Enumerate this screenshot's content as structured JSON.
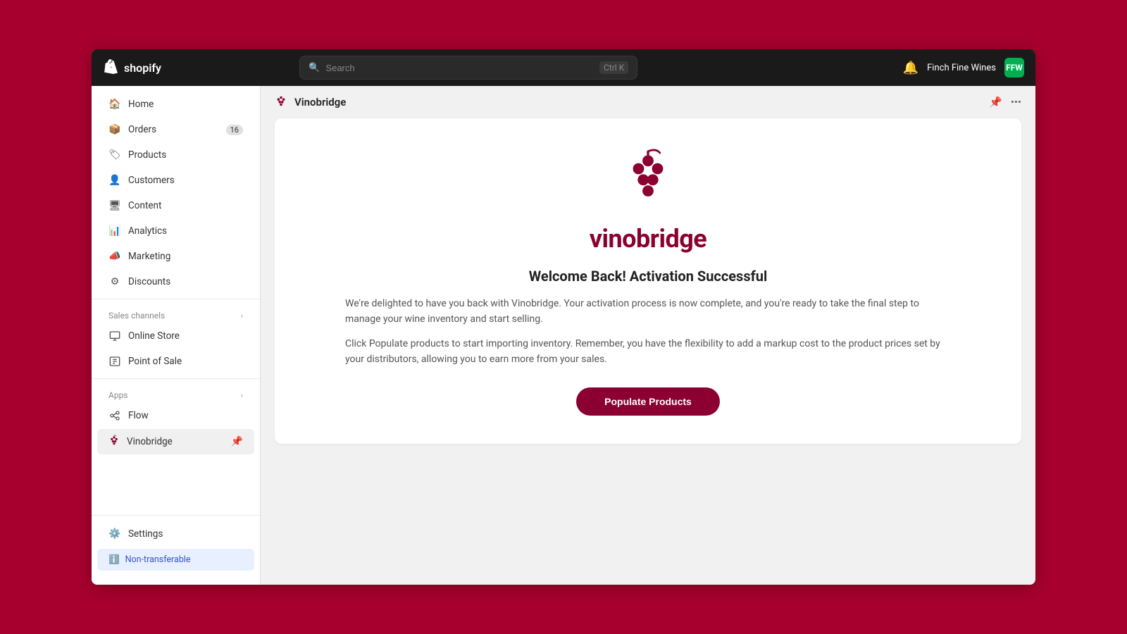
{
  "topbar": {
    "logo_text": "shopify",
    "search_placeholder": "Search",
    "search_shortcut": "Ctrl K",
    "store_name": "Finch Fine Wines",
    "store_avatar": "FFW"
  },
  "sidebar": {
    "items": [
      {
        "id": "home",
        "label": "Home",
        "icon": "house"
      },
      {
        "id": "orders",
        "label": "Orders",
        "icon": "box",
        "badge": "16"
      },
      {
        "id": "products",
        "label": "Products",
        "icon": "tag"
      },
      {
        "id": "customers",
        "label": "Customers",
        "icon": "person"
      },
      {
        "id": "content",
        "label": "Content",
        "icon": "file"
      },
      {
        "id": "analytics",
        "label": "Analytics",
        "icon": "bar-chart"
      },
      {
        "id": "marketing",
        "label": "Marketing",
        "icon": "megaphone"
      },
      {
        "id": "discounts",
        "label": "Discounts",
        "icon": "percent"
      }
    ],
    "sales_channels_label": "Sales channels",
    "sales_channels": [
      {
        "id": "online-store",
        "label": "Online Store",
        "icon": "store"
      },
      {
        "id": "point-of-sale",
        "label": "Point of Sale",
        "icon": "pos"
      }
    ],
    "apps_label": "Apps",
    "apps": [
      {
        "id": "flow",
        "label": "Flow",
        "icon": "flow"
      },
      {
        "id": "vinobridge",
        "label": "Vinobridge",
        "icon": "grape"
      }
    ],
    "settings_label": "Settings",
    "non_transferable_label": "Non-transferable"
  },
  "page_header": {
    "title": "Vinobridge"
  },
  "card": {
    "logo_text": "vinobridge",
    "title": "Welcome Back! Activation Successful",
    "body1": "We're delighted to have you back with Vinobridge. Your activation process is now complete, and you're ready to take the final step to manage your wine inventory and start selling.",
    "body2": "Click Populate products to start importing inventory. Remember, you have the flexibility to add a markup cost to the product prices set by your distributors, allowing you to earn more from your sales.",
    "cta_button": "Populate Products"
  }
}
